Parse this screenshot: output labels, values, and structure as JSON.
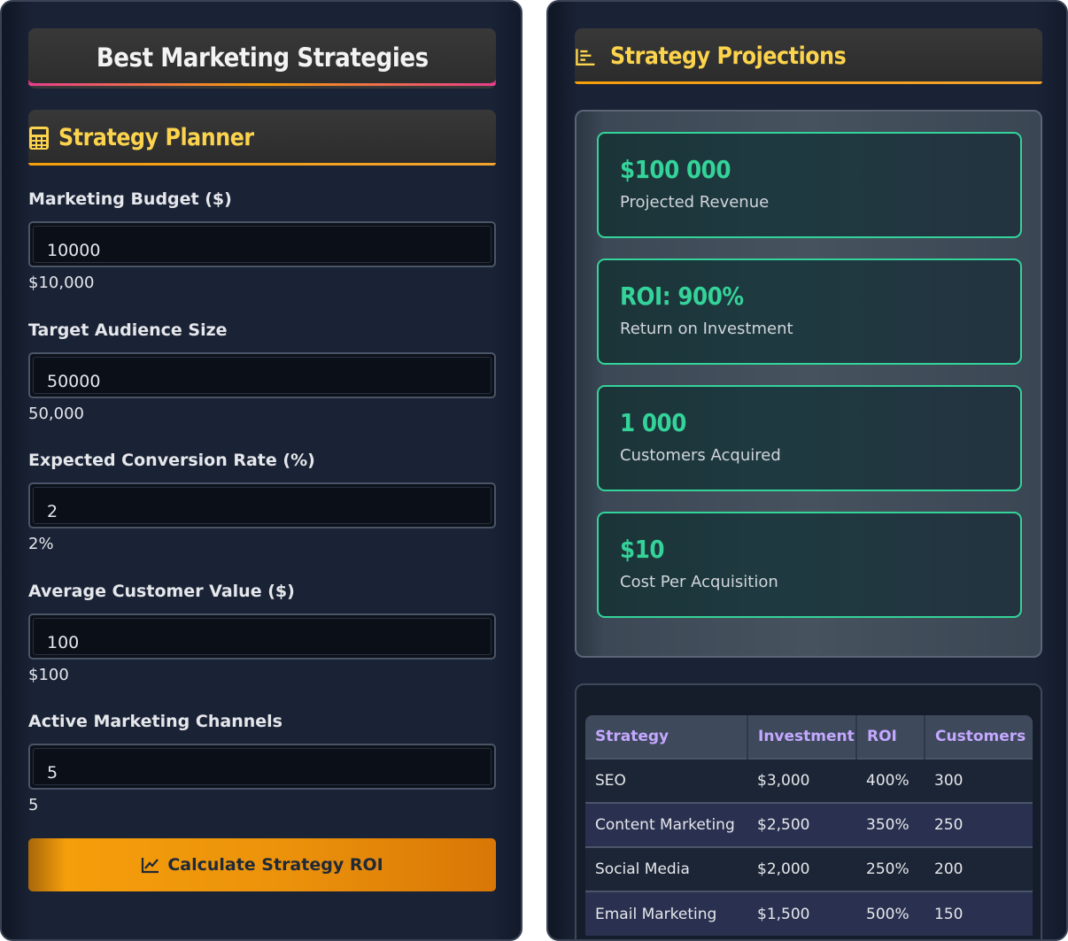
{
  "left": {
    "title": "Best Marketing Strategies",
    "planner_title": "Strategy Planner",
    "fields": [
      {
        "label": "Marketing Budget ($)",
        "value": "10000",
        "display": "$10,000"
      },
      {
        "label": "Target Audience Size",
        "value": "50000",
        "display": "50,000"
      },
      {
        "label": "Expected Conversion Rate (%)",
        "value": "2",
        "display": "2%"
      },
      {
        "label": "Average Customer Value ($)",
        "value": "100",
        "display": "$100"
      },
      {
        "label": "Active Marketing Channels",
        "value": "5",
        "display": "5"
      }
    ],
    "button_label": "Calculate Strategy ROI"
  },
  "right": {
    "title": "Strategy Projections",
    "cards": [
      {
        "value": "$100 000",
        "label": "Projected Revenue"
      },
      {
        "value": "ROI: 900%",
        "label": "Return on Investment"
      },
      {
        "value": "1 000",
        "label": "Customers Acquired"
      },
      {
        "value": "$10",
        "label": "Cost Per Acquisition"
      }
    ],
    "table": {
      "headers": [
        "Strategy",
        "Investment",
        "ROI",
        "Customers"
      ],
      "rows": [
        [
          "SEO",
          "$3,000",
          "400%",
          "300"
        ],
        [
          "Content Marketing",
          "$2,500",
          "350%",
          "250"
        ],
        [
          "Social Media",
          "$2,000",
          "250%",
          "200"
        ],
        [
          "Email Marketing",
          "$1,500",
          "500%",
          "150"
        ]
      ]
    }
  },
  "colors": {
    "accent_gold": "#fcd34d",
    "accent_green": "#34d399",
    "header_purple": "#c4a8ff",
    "button_orange": "#f59e0b"
  },
  "icons": {
    "planner": "calculator-icon",
    "projections": "bar-chart-icon",
    "button": "line-chart-icon"
  }
}
